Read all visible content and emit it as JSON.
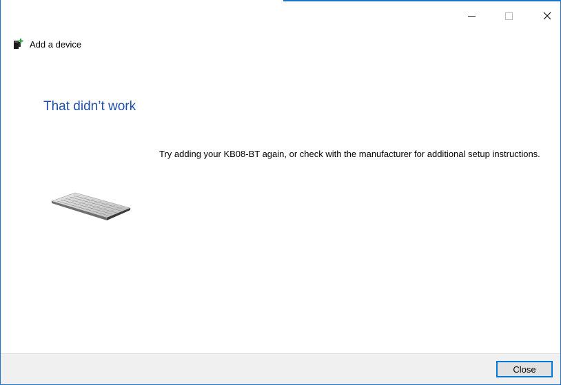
{
  "window": {
    "title": "Add a device",
    "controls": {
      "minimize_icon": "minimize-icon",
      "maximize_icon": "maximize-icon",
      "close_icon": "close-icon"
    }
  },
  "main": {
    "heading": "That didn’t work",
    "message": "Try adding your KB08-BT again, or check with the manufacturer for additional setup instructions.",
    "device_icon": "keyboard-icon"
  },
  "footer": {
    "close_label": "Close"
  },
  "colors": {
    "accent": "#0078d7",
    "heading": "#1f4fa8",
    "footer_bg": "#f0f0f0"
  }
}
